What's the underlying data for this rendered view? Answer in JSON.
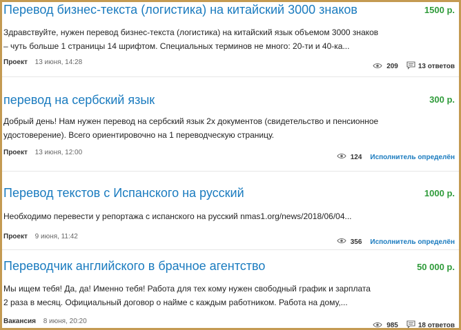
{
  "listings": [
    {
      "title": "Перевод бизнес-текста (логистика) на китайский 3000 знаков",
      "price": "1500 р.",
      "desc_line1": "Здравствуйте, нужен перевод бизнес-текста (логистика) на китайский язык объемом 3000 знаков",
      "desc_line2": "– чуть больше 1 страницы 14 шрифтом. Специальных терминов не много:  20-ти и 40-ка...",
      "type": "Проект",
      "date": "13 июня, 14:28",
      "views": "209",
      "answers": "13 ответов",
      "icons": [
        "eye-icon",
        "comment-icon"
      ]
    },
    {
      "title": "перевод на сербский язык",
      "price": "300 р.",
      "desc_line1": "Добрый день!   Нам нужен перевод на сербский язык 2х документов (свидетельство и пенсионное",
      "desc_line2": "удостоверение).  Всего ориентировочно на 1 переводческую страницу.",
      "type": "Проект",
      "date": "13 июня, 12:00",
      "views": "124",
      "status": "Исполнитель определён",
      "icons": [
        "eye-icon"
      ]
    },
    {
      "title": "Перевод текстов с Испанского на русский",
      "price": "1000 р.",
      "desc_line1": "Необходимо перевести у репортажа с испанского на русский  nmas1.org/news/2018/06/04...",
      "type": "Проект",
      "date": "9 июня, 11:42",
      "views": "356",
      "status": "Исполнитель определён",
      "icons": [
        "eye-icon"
      ]
    },
    {
      "title": "Переводчик английского в брачное агентство",
      "price": "50 000 р.",
      "desc_line1": "Мы ищем тебя! Да, да! Именно тебя! Работа для тех кому нужен свободный график и зарплата",
      "desc_line2": " 2 раза в месяц. Официальный договор о найме с каждым работником. Работа на дому,...",
      "type": "Вакансия",
      "date": "8 июня, 20:20",
      "views": "985",
      "answers": "18 ответов",
      "icons": [
        "eye-icon",
        "comment-icon"
      ]
    }
  ],
  "colors": {
    "frame": "#c49a52",
    "title": "#1a7bbf",
    "price": "#2f9b3a",
    "status": "#1a7bbf"
  }
}
